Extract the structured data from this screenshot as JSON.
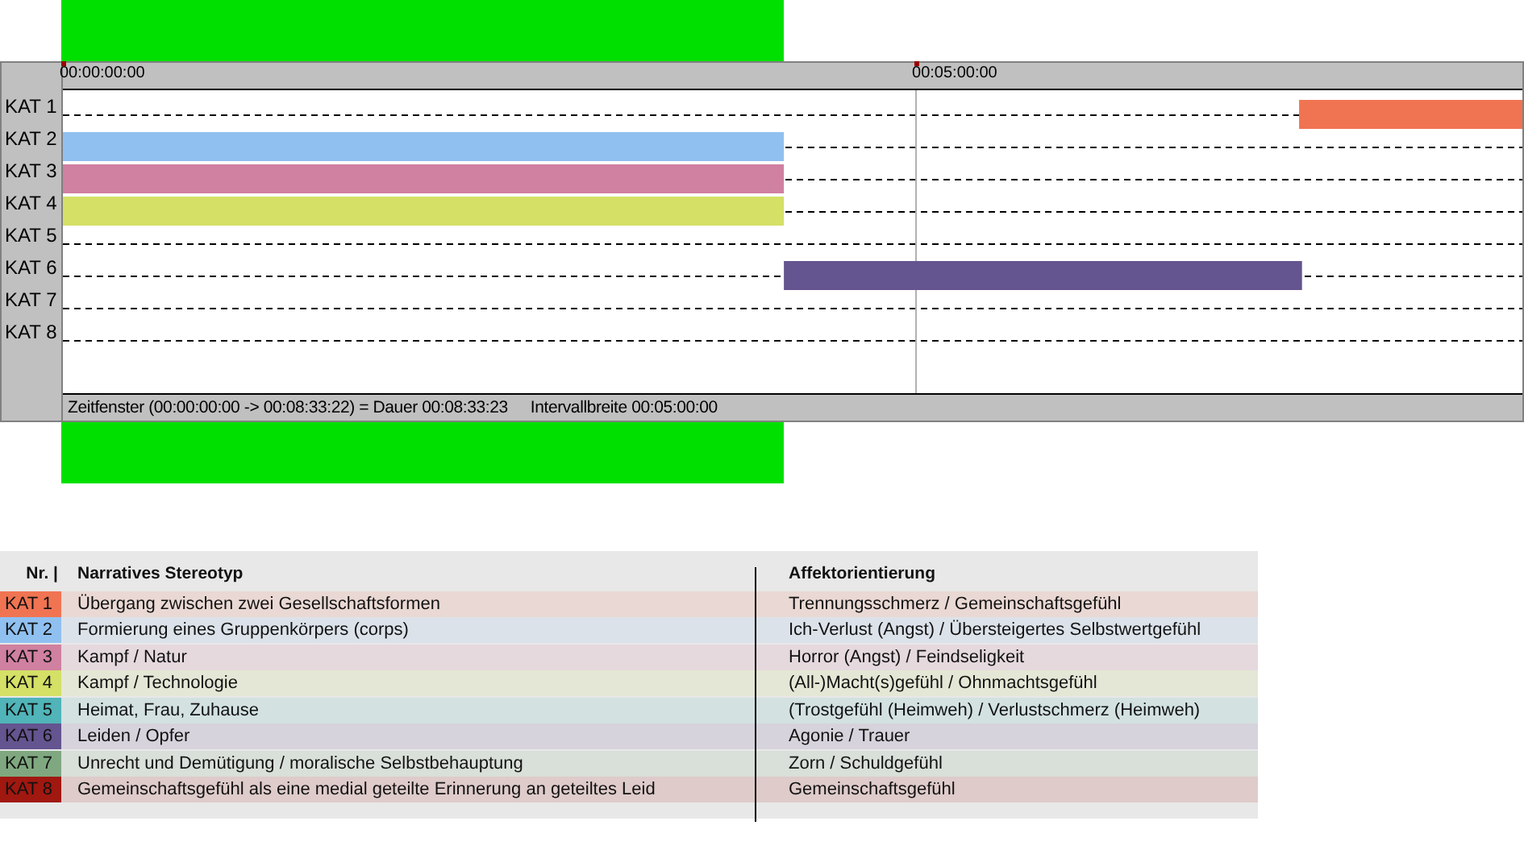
{
  "timeline": {
    "rows": [
      "KAT 1",
      "KAT 2",
      "KAT 3",
      "KAT 4",
      "KAT 5",
      "KAT 6",
      "KAT 7",
      "KAT 8"
    ],
    "ruler": [
      "00:00:00:00",
      "00:05:00:00"
    ],
    "status_bar": {
      "window": "Zeitfenster (00:00:00:00 -> 00:08:33:22) = Dauer 00:08:33:23",
      "interval": "Intervallbreite 00:05:00:00"
    }
  },
  "legend": {
    "columns": [
      "Nr. |",
      "Narratives Stereotyp",
      "Affektorientierung"
    ],
    "rows": [
      {
        "tag": "KAT 1",
        "color": "#f07452",
        "stereotype": "Übergang zwischen zwei Gesellschaftsformen",
        "affect": "Trennungsschmerz / Gemeinschaftsgefühl"
      },
      {
        "tag": "KAT 2",
        "color": "#90c0f0",
        "stereotype": "Formierung eines Gruppenkörpers (corps)",
        "affect": "Ich-Verlust (Angst) / Übersteigertes Selbstwertgefühl"
      },
      {
        "tag": "KAT 3",
        "color": "#d080a0",
        "stereotype": "Kampf / Natur",
        "affect": "Horror (Angst) / Feindseligkeit"
      },
      {
        "tag": "KAT 4",
        "color": "#d4e066",
        "stereotype": "Kampf / Technologie",
        "affect": "(All-)Macht(s)gefühl / Ohnmachtsgefühl"
      },
      {
        "tag": "KAT 5",
        "color": "#50b4b8",
        "stereotype": "Heimat, Frau, Zuhause",
        "affect": "(Trostgefühl (Heimweh) / Verlustschmerz (Heimweh)"
      },
      {
        "tag": "KAT 6",
        "color": "#64548f",
        "stereotype": "Leiden / Opfer",
        "affect": "Agonie / Trauer"
      },
      {
        "tag": "KAT 7",
        "color": "#80a880",
        "stereotype": "Unrecht und Demütigung / moralische Selbstbehauptung",
        "affect": "Zorn / Schuldgefühl"
      },
      {
        "tag": "KAT 8",
        "color": "#a01810",
        "stereotype": "Gemeinschaftsgefühl als eine medial geteilte Erinnerung an geteiltes Leid",
        "affect": "Gemeinschaftsgefühl"
      }
    ]
  }
}
